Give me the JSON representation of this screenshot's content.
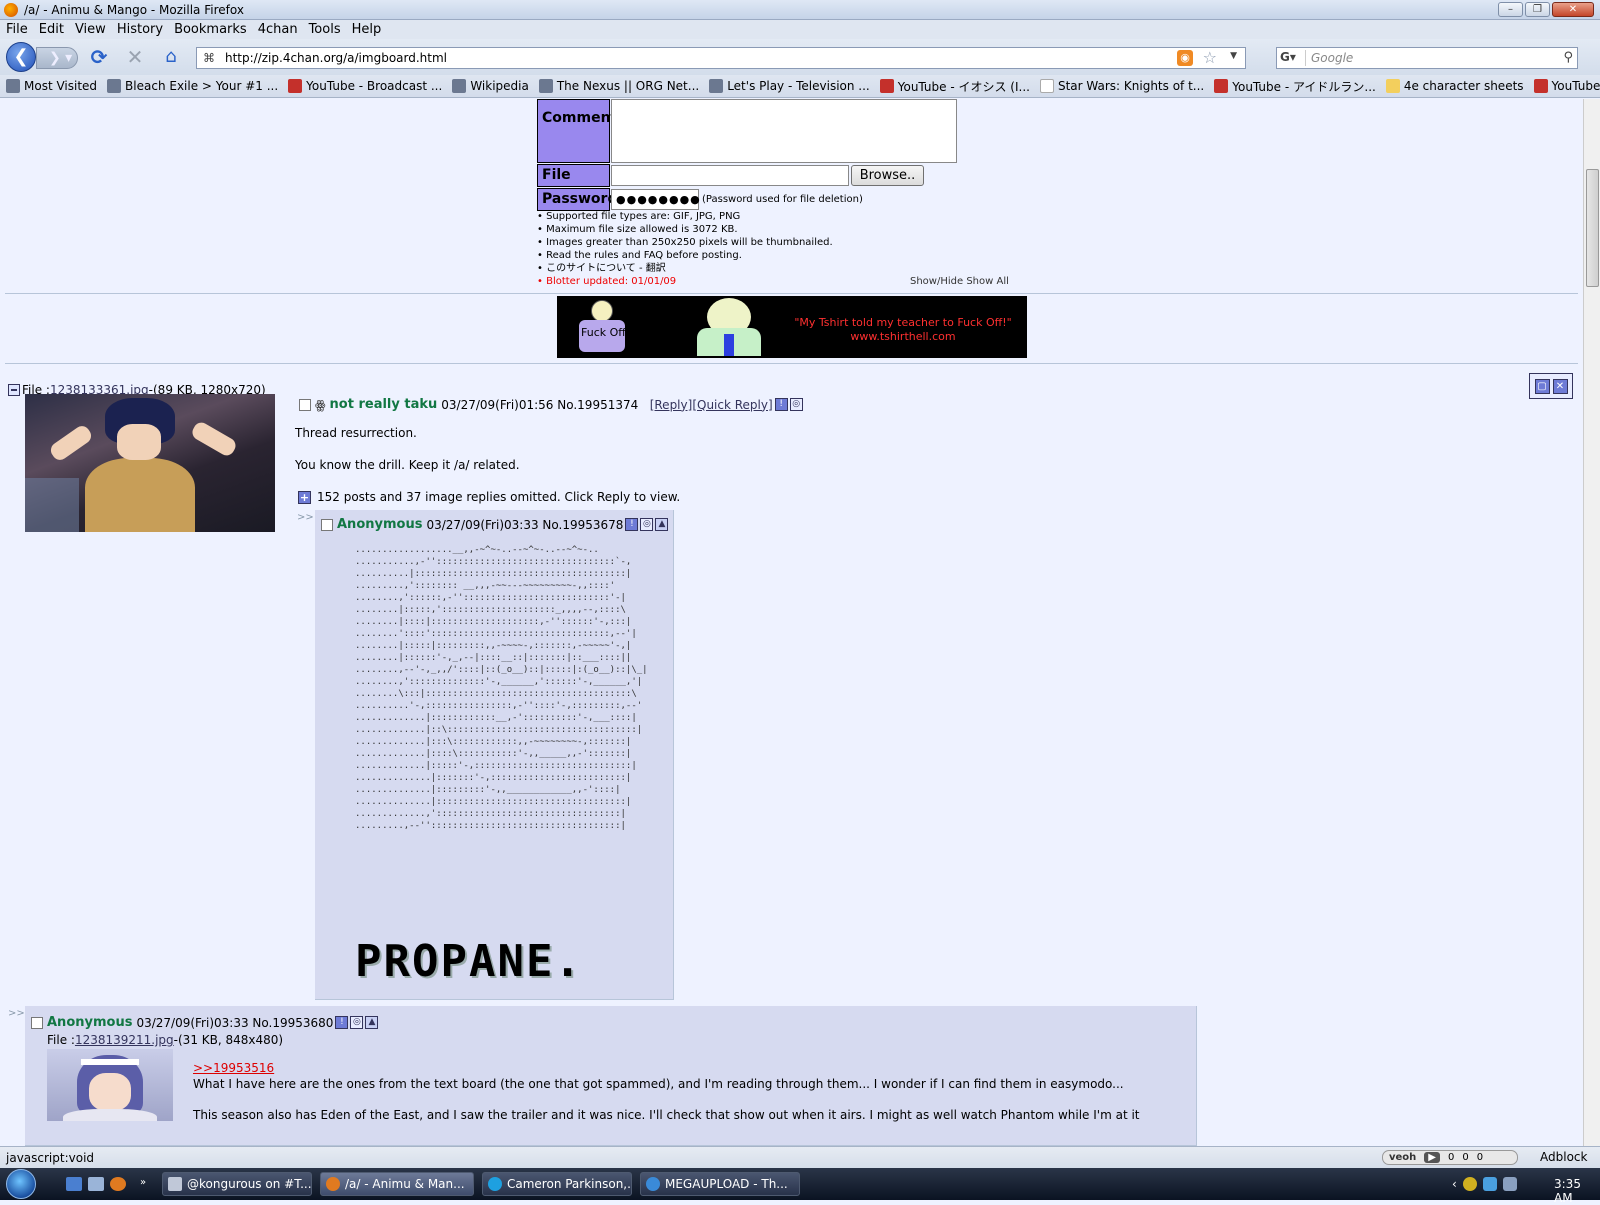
{
  "window": {
    "title": "/a/ - Animu & Mango - Mozilla Firefox"
  },
  "menu": [
    "File",
    "Edit",
    "View",
    "History",
    "Bookmarks",
    "4chan",
    "Tools",
    "Help"
  ],
  "nav": {
    "url": "http://zip.4chan.org/a/imgboard.html",
    "search_placeholder": "Google"
  },
  "bookmarks": [
    {
      "label": "Most Visited",
      "icon": "gen"
    },
    {
      "label": "Bleach Exile > Your #1 ...",
      "icon": "gen"
    },
    {
      "label": "YouTube - Broadcast ...",
      "icon": "yt"
    },
    {
      "label": "Wikipedia",
      "icon": "gen"
    },
    {
      "label": "The Nexus || ORG Net...",
      "icon": "gen"
    },
    {
      "label": "Let's Play - Television ...",
      "icon": "gen"
    },
    {
      "label": "YouTube - イオシス (I...",
      "icon": "yt"
    },
    {
      "label": "Star Wars: Knights of t...",
      "icon": "page"
    },
    {
      "label": "YouTube - アイドルラン...",
      "icon": "yt"
    },
    {
      "label": "4e character sheets",
      "icon": "folder"
    },
    {
      "label": "YouTube - Sivastopol ...",
      "icon": "yt"
    }
  ],
  "form": {
    "comment_label": "Comment",
    "file_label": "File",
    "browse_label": "Browse..",
    "password_label": "Password",
    "password_value": "●●●●●●●●",
    "password_note": "(Password used for file deletion)",
    "rules": [
      "• Supported file types are: GIF, JPG, PNG",
      "• Maximum file size allowed is 3072 KB.",
      "• Images greater than 250x250 pixels will be thumbnailed.",
      "• Read the rules and FAQ before posting.",
      "• このサイトについて - 翻訳"
    ],
    "blotter": "• Blotter updated: 01/01/09",
    "showhide": "Show/Hide Show All"
  },
  "banner": {
    "bubble": "Fuck Off!",
    "line1": "\"My Tshirt told my teacher to Fuck Off!\"",
    "line2": "www.tshirthell.com"
  },
  "op": {
    "file_prefix": "File :",
    "file_name": "1238133361.jpg",
    "file_meta": "-(89 KB, 1280x720)",
    "name": "not really taku",
    "datetime": "03/27/09(Fri)01:56",
    "number": "No.19951374",
    "reply": "[Reply]",
    "quick_reply": "[Quick Reply]",
    "line1": "Thread resurrection.",
    "line2": "You know the drill. Keep it /a/ related.",
    "omitted": "152 posts and 37 image replies omitted. Click Reply to view."
  },
  "reply1": {
    "arrows": ">>",
    "name": "Anonymous",
    "datetime": "03/27/09(Fri)03:33",
    "number": "No.19953678",
    "ascii": "..................__,,-~^~-..--~^~-..--~^~-..\n...........,-'':::::::::::::::::::::::::::::::::`-,\n..........|:::::::::::::::::::::::::::::::::::::::|\n.........,':::::::: __,,,-~~---~~~~~~~~~-,,::::'\n........,'::::::,-'':::::::::::::::::::::::::::'-|\n........|:::::,':::::::::::::::::::::_,,,,--,::::\\\n........|::::|::::::::::::::::::::,-''::::::'-,:::|\n........'::::':::::::::::::::::::::::::::::::::,--'|\n........|:::::|:::::::::,,-~~~~-,:::::::,-~~~~~'-,|\n........|::::::'-,_,--|::::__::|:::::::|::___::::||\n........,--'-,_,,/'::::|::(_o__)::|:::::|:(_o__)::|\\_|\n........,'::::::::::::::'-,______,'::::::'-,______,'|\n........\\:::|::::::::::::::::::::::::::::::::::::::\\\n..........'-,::::::::::::::::,-''::::'-,:::::::::,--'\n.............|::::::::::::__,-'::::::::::'-,___::::|\n.............|::\\:::::::::::::::::::::::::::::::::::|\n.............|:::\\::::::::::::,,-~~~~~~~~-,:::::::|\n.............|::::\\:::::::::::'-,,_____,,-':::::::|\n.............|:::::'-,:::::::::::::::::::::::::::::|\n..............|:::::::'-,:::::::::::::::::::::::::|\n..............|:::::::::'-,,____________,,-'::::|\n..............|:::::::::::::::::::::::::::::::::::|\n.............,'::::::::::::::::::::::::::::::::::|\n.........,--'':::::::::::::::::::::::::::::::::::|",
    "big_text": "PROPANE."
  },
  "reply2": {
    "arrows": ">>",
    "name": "Anonymous",
    "datetime": "03/27/09(Fri)03:33",
    "number": "No.19953680",
    "file_prefix": "File :",
    "file_name": "1238139211.jpg",
    "file_meta": "-(31 KB, 848x480)",
    "quote": ">>19953516",
    "line1": "What I have here are the ones from the text board (the one that got spammed), and I'm reading through them... I wonder if I can find them in easymodo...",
    "line2": "This season also has Eden of the East, and I saw the trailer and it was nice. I'll check that show out when it airs. I might as well watch Phantom while I'm at it"
  },
  "status": {
    "text": "javascript:void",
    "veoh_label": "veoh",
    "veoh_counts": [
      "0",
      "0",
      "0"
    ],
    "adblock": "Adblock"
  },
  "taskbar": {
    "tasks": [
      "@kongurous on #T...",
      "/a/ - Animu & Man...",
      "Cameron Parkinson,...",
      "MEGAUPLOAD - Th..."
    ],
    "clock": "3:35 AM"
  }
}
